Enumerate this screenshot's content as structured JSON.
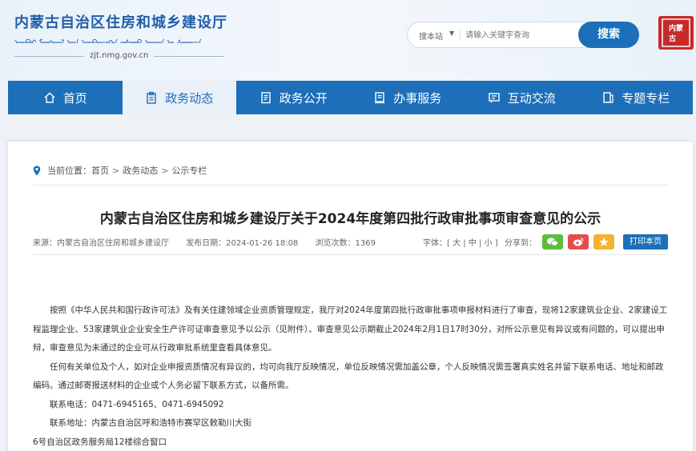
{
  "header": {
    "title": "内蒙古自治区住房和城乡建设厅",
    "mongolian": "ᠦᠪᠦᠷ ᠮᠣᠩᠭᠣᠯ ᠤᠨ ᠥᠪᠡᠷᠲᠡᠭᠡᠨ ᠵᠠᠰᠠᠬᠤ ᠣᠷᠣᠨ ᠤ ᠰᠠᠭᠤᠴᠠ",
    "url": "zjt.nmg.gov.cn",
    "seal_text": "内蒙古"
  },
  "search": {
    "scope": "搜本站",
    "placeholder": "请输入关键字查询",
    "button": "搜索"
  },
  "nav": {
    "items": [
      {
        "label": "首页",
        "icon": "home-icon"
      },
      {
        "label": "政务动态",
        "icon": "clipboard-icon"
      },
      {
        "label": "政务公开",
        "icon": "document-icon"
      },
      {
        "label": "办事服务",
        "icon": "form-icon"
      },
      {
        "label": "互动交流",
        "icon": "chat-icon"
      },
      {
        "label": "专题专栏",
        "icon": "bookmark-icon"
      }
    ],
    "active_index": 1,
    "color_bar": "#1c6fb8"
  },
  "breadcrumb": {
    "prefix": "当前位置：",
    "items": [
      "首页",
      "政务动态",
      "公示专栏"
    ],
    "separator": ">"
  },
  "article": {
    "title": "内蒙古自治区住房和城乡建设厅关于2024年度第四批行政审批事项审查意见的公示",
    "source": "来源：内蒙古自治区住房和城乡建设厅",
    "date": "发布日期：2024-01-26 18:08",
    "views": "浏览次数：1369",
    "fontsize": "字体：[ 大 | 中 | 小 ]",
    "share_label": "分享到：",
    "print": "打印本页",
    "paragraphs": [
      "按照《中华人民共和国行政许可法》及有关住建领域企业资质管理规定，我厅对2024年度第四批行政审批事项申报材料进行了审查，现将12家建筑业企业、2家建设工程监理企业、53家建筑业企业安全生产许可证审查意见予以公示（见附件）。审查意见公示期截止2024年2月1日17时30分，对所公示意见有异议或有问题的，可以提出申辩，审查意见为未通过的企业可从行政审批系统里查看具体意见。",
      "任何有关单位及个人，如对企业申报资质情况有异议的，均可向我厅反映情况，单位反映情况需加盖公章，个人反映情况需签署真实姓名并留下联系电话、地址和邮政编码。通过邮寄报送材料的企业或个人务必留下联系方式，以备所需。",
      "联系电话：0471-6945165、0471-6945092",
      "联系地址：内蒙古自治区呼和浩特市赛罕区敕勒川大街"
    ],
    "tail": "6号自治区政务服务局12楼综合窗口"
  }
}
